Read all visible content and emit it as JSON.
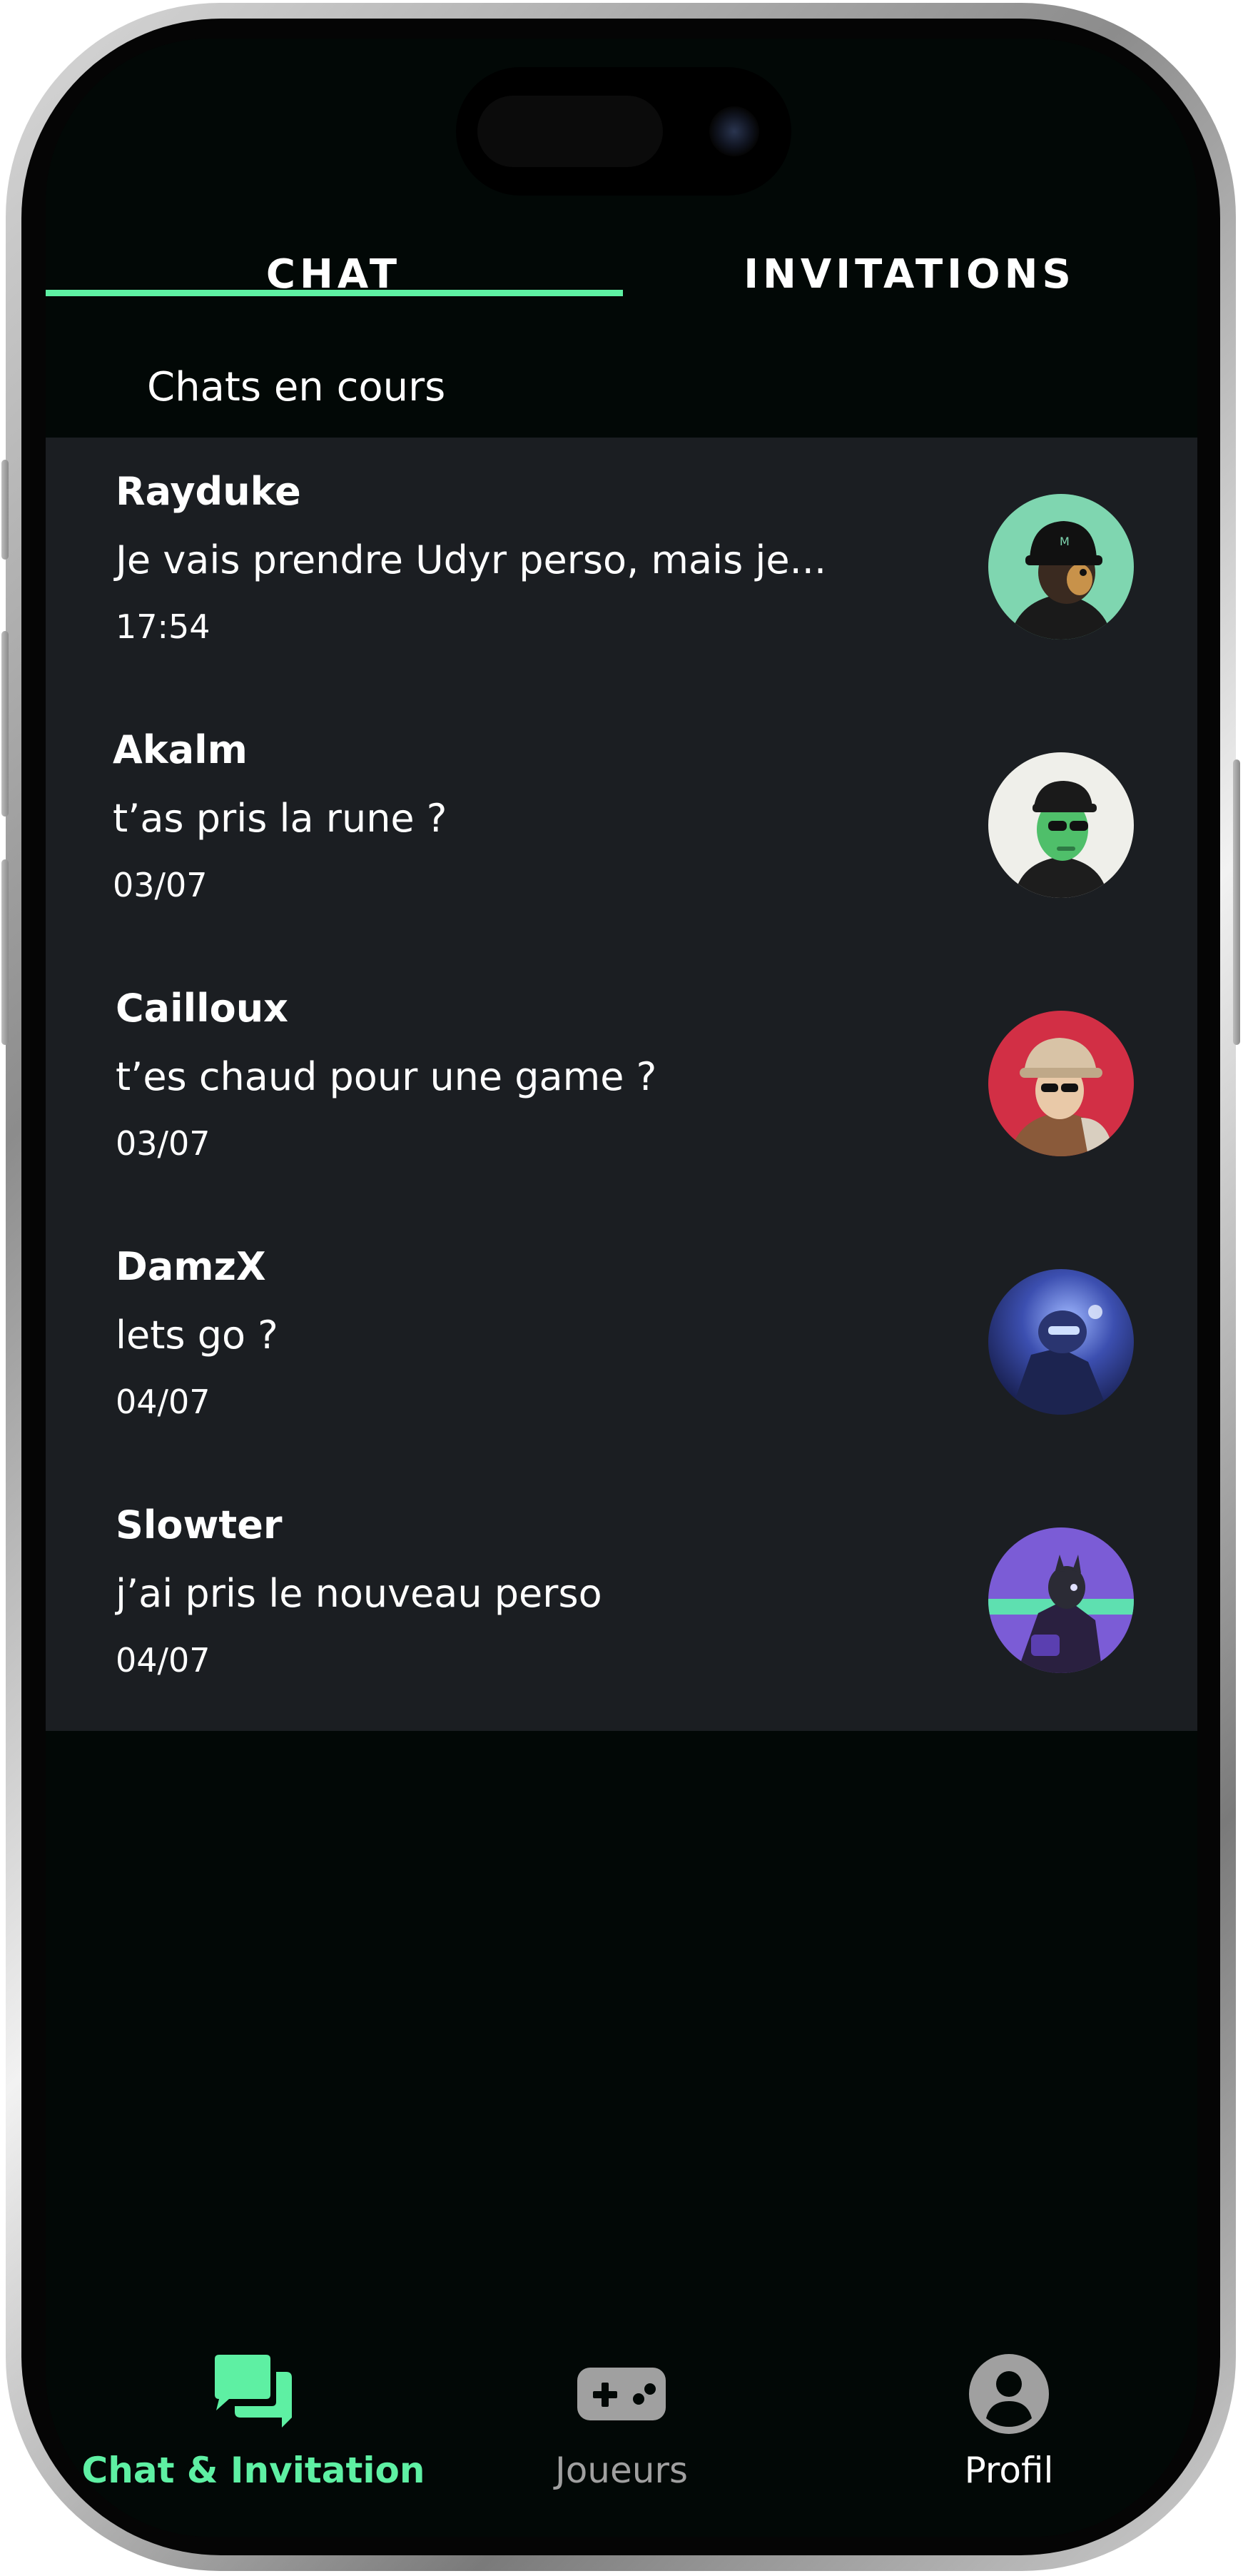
{
  "tabs": {
    "chat": "CHAT",
    "invitations": "INVITATIONS"
  },
  "section_title": "Chats en cours",
  "chats": [
    {
      "name": "Rayduke",
      "message": "Je vais prendre Udyr perso, mais je...",
      "time": "17:54"
    },
    {
      "name": "Akalm",
      "message": "t’as pris la rune ?",
      "time": "03/07"
    },
    {
      "name": "Cailloux",
      "message": "t’es chaud pour une game ?",
      "time": "03/07"
    },
    {
      "name": "DamzX",
      "message": "lets go ?",
      "time": "04/07"
    },
    {
      "name": "Slowter",
      "message": "j’ai pris le nouveau perso",
      "time": "04/07"
    }
  ],
  "bottom_nav": {
    "chat_invitation": "Chat & Invitation",
    "joueurs": "Joueurs",
    "profil": "Profil"
  },
  "colors": {
    "accent": "#5ef0a3",
    "background": "#020806",
    "list_background": "#1b1e22",
    "inactive_nav": "#a0a0a0",
    "active_nav": "#5ef0a3"
  },
  "icons": {
    "nav_chat": "chat-bubbles-icon",
    "nav_joueurs": "gamepad-icon",
    "nav_profil": "user-circle-icon"
  }
}
